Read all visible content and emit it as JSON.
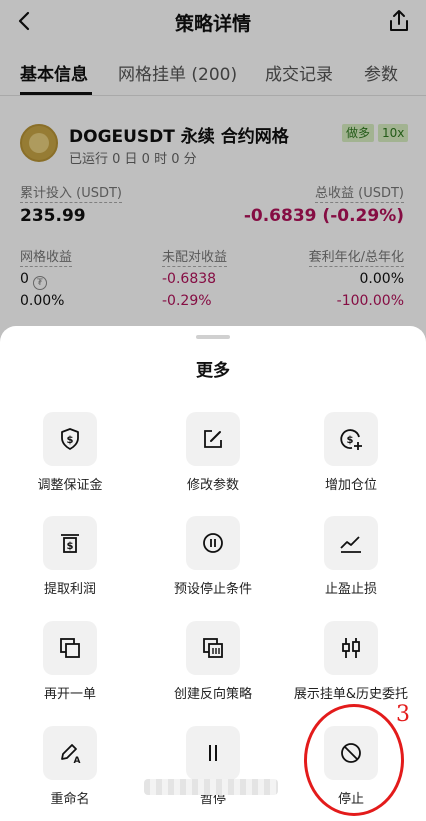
{
  "header": {
    "title": "策略详情"
  },
  "tabs": [
    {
      "label": "基本信息"
    },
    {
      "label": "网格挂单 (200)"
    },
    {
      "label": "成交记录"
    },
    {
      "label": "参数"
    }
  ],
  "strategy": {
    "name": "DOGEUSDT 永续 合约网格",
    "runtime": "已运行 0 日 0 时 0 分",
    "badge_side": "做多",
    "badge_leverage": "10x",
    "total_invest_label": "累计投入 (USDT)",
    "total_invest_value": "235.99",
    "total_profit_label": "总收益 (USDT)",
    "total_profit_value": "-0.6839 (-0.29%)",
    "grid_profit_label": "网格收益",
    "grid_profit_value": "0",
    "grid_profit_pct": "0.00%",
    "unpaired_label": "未配对收益",
    "unpaired_value": "-0.6838",
    "unpaired_pct": "-0.29%",
    "apr_label": "套利年化/总年化",
    "apr_value": "0.00%",
    "apr_total": "-100.00%"
  },
  "sheet": {
    "title": "更多",
    "items": [
      {
        "label": "调整保证金",
        "icon": "shield-dollar-icon"
      },
      {
        "label": "修改参数",
        "icon": "edit-icon"
      },
      {
        "label": "增加仓位",
        "icon": "add-dollar-icon"
      },
      {
        "label": "提取利润",
        "icon": "withdraw-icon"
      },
      {
        "label": "预设停止条件",
        "icon": "pause-circle-icon"
      },
      {
        "label": "止盈止损",
        "icon": "trend-line-icon"
      },
      {
        "label": "再开一单",
        "icon": "copy-icon"
      },
      {
        "label": "创建反向策略",
        "icon": "reverse-icon"
      },
      {
        "label": "展示挂单&历史委托",
        "icon": "candlestick-icon"
      },
      {
        "label": "重命名",
        "icon": "rename-pen-icon"
      },
      {
        "label": "暂停",
        "icon": "pause-icon"
      },
      {
        "label": "停止",
        "icon": "stop-icon"
      }
    ]
  },
  "annotation": {
    "number": "3",
    "color": "#e31b1b"
  },
  "colors": {
    "negative": "#b2125a",
    "badge_bg": "#d8efc2",
    "badge_text": "#2f7a1f"
  }
}
